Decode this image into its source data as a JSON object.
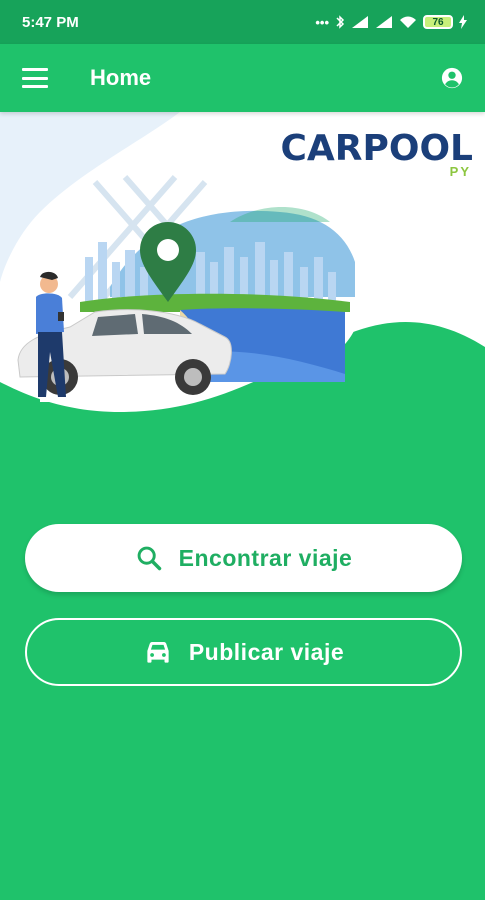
{
  "status_bar": {
    "time": "5:47 PM",
    "icons": [
      "dots-icon",
      "bluetooth-icon",
      "signal-icon",
      "signal-icon",
      "wifi-icon",
      "battery-icon",
      "charging-icon"
    ],
    "battery_level": "76"
  },
  "app_bar": {
    "title": "Home",
    "menu_icon": "menu-icon",
    "account_icon": "account-circle-icon"
  },
  "hero": {
    "logo_main": "CARPOOL",
    "logo_sub": "PY"
  },
  "actions": {
    "find_label": "Encontrar viaje",
    "find_icon": "search-icon",
    "publish_label": "Publicar viaje",
    "publish_icon": "car-icon"
  },
  "colors": {
    "primary": "#1fc26b",
    "status_bar": "#17a35a",
    "logo_blue": "#1b3f7a",
    "logo_green": "#8cc63f"
  }
}
